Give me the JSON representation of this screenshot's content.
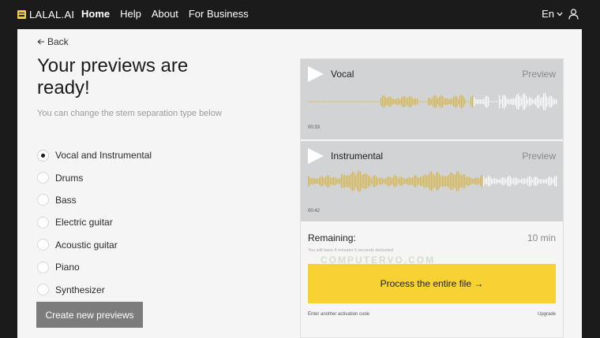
{
  "header": {
    "logo_text": "LALAL.AI",
    "nav": [
      "Home",
      "Help",
      "About",
      "For Business"
    ],
    "active_nav": "Home",
    "language": "En"
  },
  "main": {
    "back_label": "Back",
    "title": "Your previews are ready!",
    "subtitle": "You can change the stem separation type below",
    "options": [
      {
        "label": "Vocal and Instrumental",
        "checked": true
      },
      {
        "label": "Drums",
        "checked": false
      },
      {
        "label": "Bass",
        "checked": false
      },
      {
        "label": "Electric guitar",
        "checked": false
      },
      {
        "label": "Acoustic guitar",
        "checked": false
      },
      {
        "label": "Piano",
        "checked": false
      },
      {
        "label": "Synthesizer",
        "checked": false
      }
    ],
    "create_button": "Create new previews"
  },
  "card": {
    "tracks": [
      {
        "name": "Vocal",
        "preview_label": "Preview",
        "time": "00:33"
      },
      {
        "name": "Instrumental",
        "preview_label": "Preview",
        "time": "00:42"
      }
    ],
    "remaining_label": "Remaining:",
    "remaining_value": "10 min",
    "remaining_note": "You will have 4 minutes 6 seconds deducted",
    "watermark": "COMPUTERVO.COM",
    "process_button": "Process the entire file →",
    "activation_link": "Enter another activation code",
    "upgrade_link": "Upgrade"
  },
  "colors": {
    "accent_yellow": "#f7d232",
    "waveform_played": "#d6b54a",
    "waveform_unplayed": "#ffffff",
    "header_bg": "#1b1b1b"
  },
  "icons": {
    "back": "arrow-left-icon",
    "play": "play-icon",
    "user": "user-icon",
    "lang_chevron": "chevron-down-icon"
  }
}
